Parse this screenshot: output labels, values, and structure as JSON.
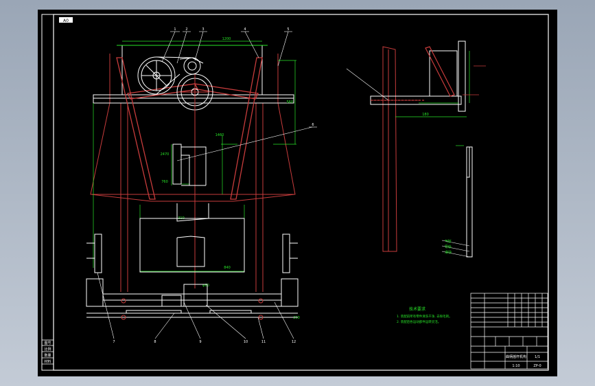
{
  "drawing": {
    "sheet_label": "A0",
    "notes_title": "技术要求",
    "notes": [
      "1. 装配前所有零件清洗干净, 去除毛刺。",
      "2. 装配后各运动部件运转灵活。"
    ],
    "part_callouts": [
      "1",
      "2",
      "3",
      "4",
      "5",
      "6",
      "7",
      "8",
      "9",
      "10",
      "11",
      "12"
    ],
    "dims": {
      "top_span": "1200",
      "height_a": "560",
      "height_b": "1460",
      "height_c": "2470",
      "side_span": "840",
      "side_offset": "180",
      "base_rise": "250",
      "label_a": "760",
      "label_b": "310",
      "label_c": "φ60"
    },
    "title_block": {
      "title": "曲柄摇杆机构",
      "drawing_no": "ZP-0",
      "scale": "1:10",
      "sheet_of": "1/1"
    },
    "side_labels": [
      "图号",
      "比例",
      "数量",
      "材料"
    ],
    "vertical_labels": [
      "气缸",
      "导轨",
      "滑块"
    ]
  },
  "colors": {
    "background": "#000000",
    "outline": "#ffffff",
    "red": "#c83c3c",
    "green": "#28e628",
    "yellow": "#e6e628"
  }
}
